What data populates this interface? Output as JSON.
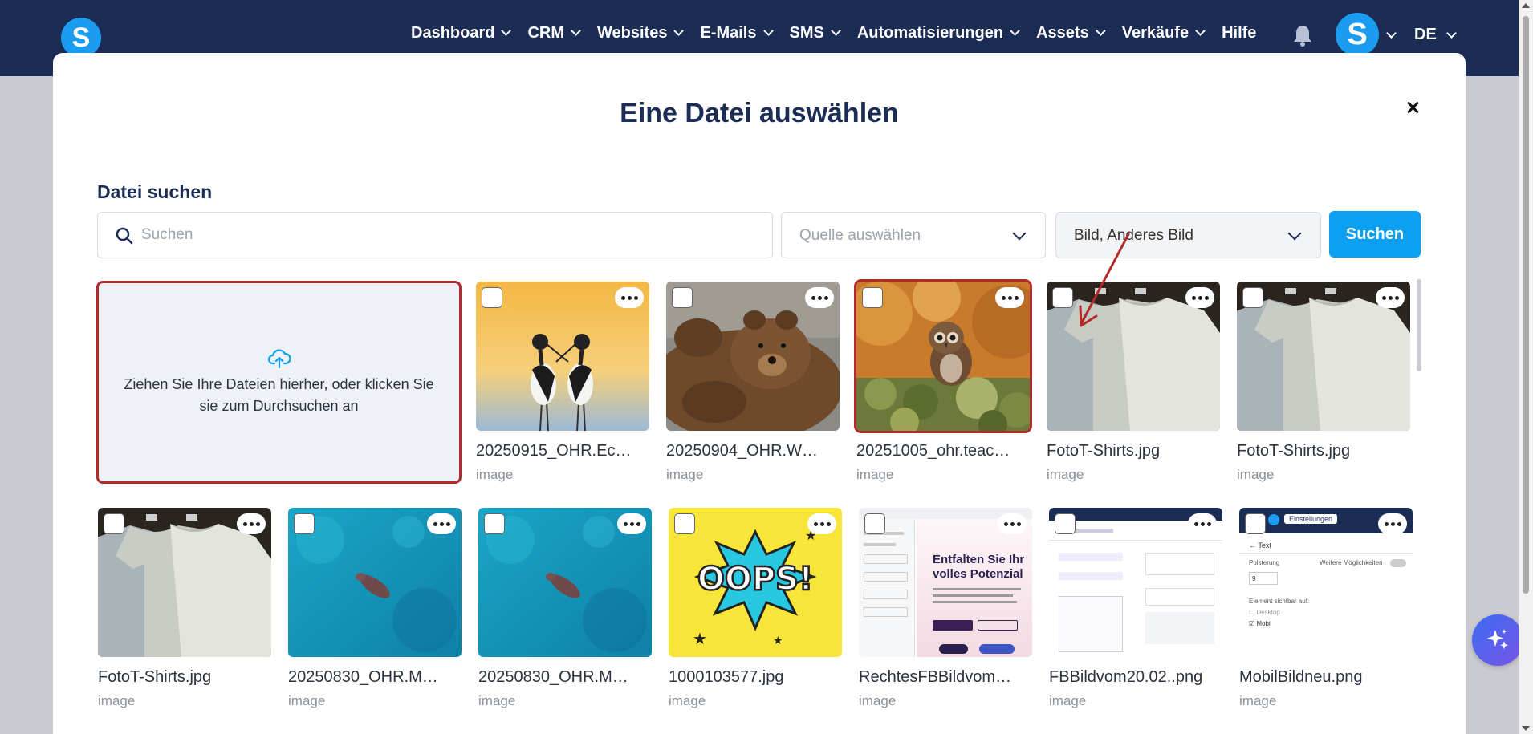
{
  "nav": {
    "items": [
      {
        "label": "Dashboard",
        "has_dropdown": true
      },
      {
        "label": "CRM",
        "has_dropdown": true
      },
      {
        "label": "Websites",
        "has_dropdown": true
      },
      {
        "label": "E-Mails",
        "has_dropdown": true
      },
      {
        "label": "SMS",
        "has_dropdown": true
      },
      {
        "label": "Automatisierungen",
        "has_dropdown": true
      },
      {
        "label": "Assets",
        "has_dropdown": true
      },
      {
        "label": "Verkäufe",
        "has_dropdown": true
      },
      {
        "label": "Hilfe",
        "has_dropdown": false
      }
    ],
    "logo_letter": "S",
    "avatar_letter": "S",
    "language": "DE"
  },
  "modal": {
    "title": "Eine Datei auswählen",
    "search_label": "Datei suchen",
    "search_placeholder": "Suchen",
    "source_placeholder": "Quelle auswählen",
    "type_value": "Bild, Anderes Bild",
    "search_button": "Suchen",
    "dropzone_text": "Ziehen Sie Ihre Dateien hierher, oder klicken Sie sie zum Durchsuchen an"
  },
  "files": [
    {
      "name": "20250915_OHR.Ec…",
      "type": "image",
      "thumb": "birds"
    },
    {
      "name": "20250904_OHR.W…",
      "type": "image",
      "thumb": "bear"
    },
    {
      "name": "20251005_ohr.teac…",
      "type": "image",
      "thumb": "owl",
      "selected": true
    },
    {
      "name": "FotoT-Shirts.jpg",
      "type": "image",
      "thumb": "tshirts"
    },
    {
      "name": "FotoT-Shirts.jpg",
      "type": "image",
      "thumb": "tshirts"
    },
    {
      "name": "FotoT-Shirts.jpg",
      "type": "image",
      "thumb": "tshirts"
    },
    {
      "name": "20250830_OHR.M…",
      "type": "image",
      "thumb": "ocean"
    },
    {
      "name": "20250830_OHR.M…",
      "type": "image",
      "thumb": "ocean"
    },
    {
      "name": "1000103577.jpg",
      "type": "image",
      "thumb": "oops"
    },
    {
      "name": "RechtesFBBildvom…",
      "type": "image",
      "thumb": "webpage"
    },
    {
      "name": "FBBildvom20.02..png",
      "type": "image",
      "thumb": "screenshot"
    },
    {
      "name": "MobilBildneu.png",
      "type": "image",
      "thumb": "mobile"
    }
  ],
  "thumb_text": {
    "oops": "OOPS!",
    "webpage_heading": "Entfalten Sie Ihr volles Potenzial",
    "mobile_button": "Einstellungen",
    "mobile_back": "Text",
    "mobile_label1": "Polsterung",
    "mobile_label2": "Weitere Möglichkeiten",
    "mobile_value": "9",
    "mobile_visible": "Element sichtbar auf:",
    "mobile_desktop": "Desktop",
    "mobile_mobil": "Mobil"
  },
  "colors": {
    "nav_bg": "#1b2c55",
    "accent": "#0ea0f0",
    "highlight": "#b22a2a"
  }
}
